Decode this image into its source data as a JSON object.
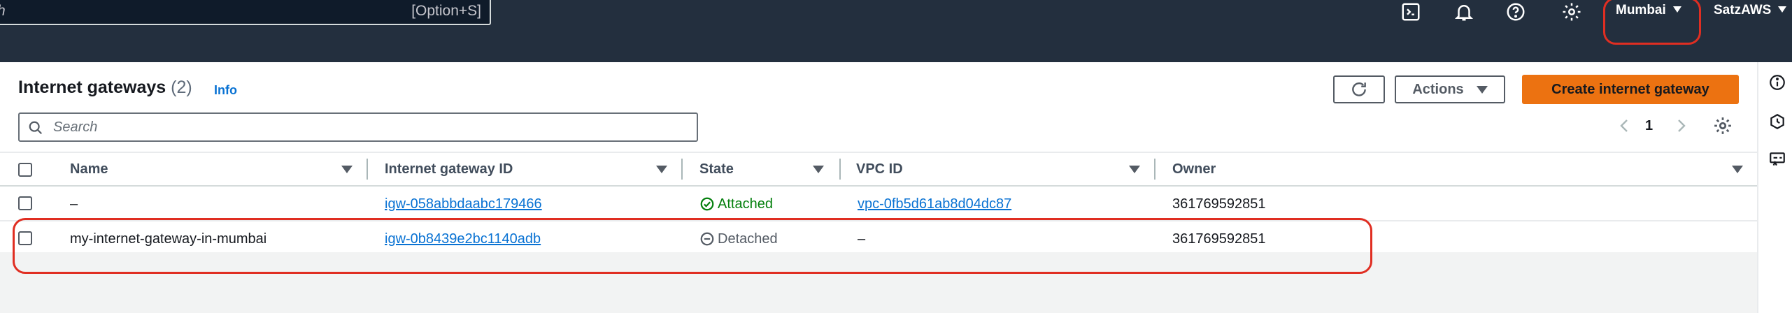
{
  "topnav": {
    "search_placeholder": "h",
    "search_shortcut": "[Option+S]",
    "region": "Mumbai",
    "user": "SatzAWS",
    "icons": [
      "cloudshell-icon",
      "bell-icon",
      "help-icon",
      "settings-icon"
    ]
  },
  "panel": {
    "title": "Internet gateways",
    "count": "(2)",
    "info": "Info",
    "actions_label": "Actions",
    "create_label": "Create internet gateway",
    "search_placeholder": "Search",
    "page": "1"
  },
  "table": {
    "columns": [
      "Name",
      "Internet gateway ID",
      "State",
      "VPC ID",
      "Owner"
    ],
    "rows": [
      {
        "name": "–",
        "igw_id": "igw-058abbdaabc179466",
        "state": "Attached",
        "vpc_id": "vpc-0fb5d61ab8d04dc87",
        "owner": "361769592851"
      },
      {
        "name": "my-internet-gateway-in-mumbai",
        "igw_id": "igw-0b8439e2bc1140adb",
        "state": "Detached",
        "vpc_id": "–",
        "owner": "361769592851"
      }
    ]
  },
  "colors": {
    "nav_bg": "#232f3e",
    "primary_button": "#ec7211",
    "link": "#0972d3",
    "attached": "#037f0c",
    "highlight": "#e02e22"
  }
}
